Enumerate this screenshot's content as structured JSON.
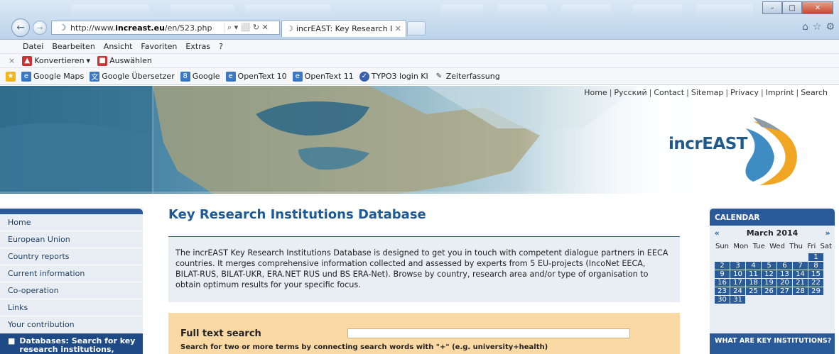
{
  "browser": {
    "url_prefix": "http://www.",
    "url_domain": "increast.eu",
    "url_path": "/en/523.php",
    "url_controls": "⌕ ▾ ⬜ ↻ ✕",
    "tab_title": "incrEAST: Key Research Inst...",
    "tab_close": "✕",
    "window_min": "–",
    "window_max": "□",
    "window_close": "✕",
    "menu": [
      "Datei",
      "Bearbeiten",
      "Ansicht",
      "Favoriten",
      "Extras",
      "?"
    ],
    "cmd": {
      "close": "×",
      "convert": "Konvertieren",
      "convert_arrow": "▾",
      "select": "Auswählen"
    },
    "favorites": [
      {
        "label": "Google Maps",
        "icon": "page-icon",
        "color": "#3b79c4"
      },
      {
        "label": "Google Übersetzer",
        "icon": "translate-icon",
        "color": "#3b79c4"
      },
      {
        "label": "Google",
        "icon": "google-icon",
        "color": "#3b79c4"
      },
      {
        "label": "OpenText 10",
        "icon": "page-icon",
        "color": "#3b79c4"
      },
      {
        "label": "OpenText 11",
        "icon": "page-icon",
        "color": "#3b79c4"
      },
      {
        "label": "TYPO3 login KI",
        "icon": "typo3-icon",
        "color": "#e06c1a"
      },
      {
        "label": "Zeiterfassung",
        "icon": "pen-icon",
        "color": "#333333"
      }
    ]
  },
  "site": {
    "toplinks": [
      "Home",
      "Русский",
      "Contact",
      "Sitemap",
      "Privacy",
      "Imprint",
      "Search"
    ],
    "logo_text": "incrEAST",
    "nav": [
      "Home",
      "European Union",
      "Country reports",
      "Current information",
      "Co-operation",
      "Links",
      "Your contribution"
    ],
    "nav_active": "Databases: Search for key research institutions, funding",
    "nav_bullet": "■",
    "title": "Key Research Institutions Database",
    "intro": "The incrEAST Key Research Institutions Database is designed to get you in touch with competent dialogue partners in EECA countries. It merges comprehensive information collected and assessed by experts from 5 EU-projects (IncoNet EECA, BILAT-RUS, BILAT-UKR, ERA.NET RUS und BS ERA-Net). Browse by country, research area and/or type of organisation to obtain optimum results for your specific focus.",
    "search_label": "Full text search",
    "search_value": "",
    "search_hint": "Search for two or more terms by connecting search words with \"+\" (e.g. university+health)"
  },
  "calendar": {
    "header": "CALENDAR",
    "prev": "«",
    "next": "»",
    "month": "March 2014",
    "weekdays": [
      "Sun",
      "Mon",
      "Tue",
      "Wed",
      "Thu",
      "Fri",
      "Sat"
    ],
    "first_weekday_index": 6,
    "days": 31,
    "footer": "WHAT ARE KEY INSTITUTIONS?"
  },
  "colors": {
    "nav_active": "#1e4a85",
    "calendar_blue": "#2a5a9a",
    "title_blue": "#1d5a9a",
    "search_bg": "#fbd9a4"
  }
}
